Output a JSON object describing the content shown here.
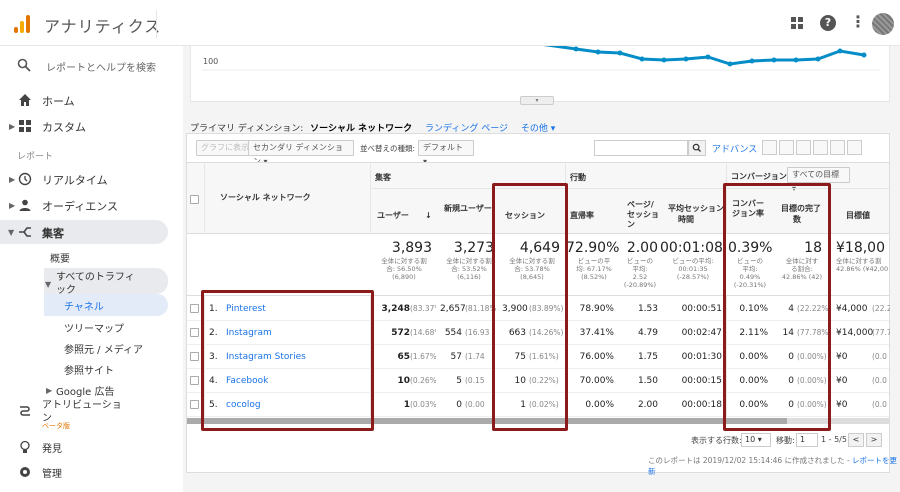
{
  "header": {
    "app_title": "アナリティクス"
  },
  "sidebar": {
    "search_placeholder": "レポートとヘルプを検索",
    "home": "ホーム",
    "custom": "カスタム",
    "section_report": "レポート",
    "realtime": "リアルタイム",
    "audience": "オーディエンス",
    "acquisition": "集客",
    "overview": "概要",
    "all_traffic_l1": "すべてのトラフィ",
    "all_traffic_l2": "ック",
    "channels": "チャネル",
    "treemap": "ツリーマップ",
    "source_medium": "参照元 / メディア",
    "referrals": "参照サイト",
    "google_ads": "Google 広告",
    "attribution_l1": "アトリビューショ",
    "attribution_l2": "ン",
    "beta": "ベータ版",
    "discover": "発見",
    "admin": "管理"
  },
  "chart": {
    "y_label": "100"
  },
  "dimension_bar": {
    "label": "プライマリ ディメンション:",
    "selected": "ソーシャル ネットワーク",
    "landing": "ランディング ページ",
    "other": "その他"
  },
  "toolbar": {
    "plot_rows": "グラフに表示",
    "secondary_dim": "セカンダリ ディメンション",
    "sort_type_label": "並べ替えの種類:",
    "sort_default": "デフォルト",
    "advanced": "アドバンス"
  },
  "table": {
    "dim_header": "ソーシャル ネットワーク",
    "group_acq": "集客",
    "group_behavior": "行動",
    "group_conv": "コンバージョン",
    "goal_select": "すべての目標",
    "cols": {
      "users": "ユーザー",
      "new_users": "新規ユーザー",
      "sessions": "セッション",
      "bounce": "直帰率",
      "pages_l1": "ページ/",
      "pages_l2": "セッショ",
      "pages_l3": "ン",
      "avg_dur_l1": "平均セッション",
      "avg_dur_l2": "時間",
      "conv_l1": "コンバー",
      "conv_l2": "ジョン率",
      "goal_comp_l1": "目標の完了",
      "goal_comp_l2": "数",
      "goal_value": "目標値"
    },
    "totals": {
      "users": "3,893",
      "users_sub1": "全体に対する割",
      "users_sub2": "合: 56.50%",
      "users_sub3": "(6,890)",
      "new_users": "3,273",
      "new_users_sub1": "全体に対する割",
      "new_users_sub2": "合: 53.52%",
      "new_users_sub3": "(6,116)",
      "sessions": "4,649",
      "sessions_sub1": "全体に対する割",
      "sessions_sub2": "合: 53.78%",
      "sessions_sub3": "(8,645)",
      "bounce": "72.90%",
      "bounce_sub1": "ビューの平",
      "bounce_sub2": "均: 67.17%",
      "bounce_sub3": "(8.52%)",
      "pages": "2.00",
      "pages_sub1": "ビューの",
      "pages_sub2": "平均:",
      "pages_sub3": "2.52",
      "pages_sub4": "(-20.89%)",
      "duration": "00:01:08",
      "duration_sub1": "ビューの平均:",
      "duration_sub2": "00:01:35",
      "duration_sub3": "(-28.57%)",
      "conv": "0.39%",
      "conv_sub1": "ビューの",
      "conv_sub2": "平均:",
      "conv_sub3": "0.49%",
      "conv_sub4": "(-20.31%)",
      "goals": "18",
      "goals_sub1": "全体に対す",
      "goals_sub2": "る割合:",
      "goals_sub3": "42.86% (42)",
      "value": "¥18,00",
      "value_sub1": "全体に対する割",
      "value_sub2": "42.86% (¥42,00"
    },
    "rows": [
      {
        "idx": "1.",
        "name": "Pinterest",
        "users": "3,248",
        "users_pct": "(83.37%)",
        "new": "2,657",
        "new_pct": "(81.18%",
        "sessions": "3,900",
        "sessions_pct": "(83.89%)",
        "bounce": "78.90%",
        "pages": "1.53",
        "duration": "00:00:51",
        "conv": "0.10%",
        "goals": "4",
        "goals_pct": "(22.22%)",
        "value": "¥4,000",
        "value_pct": "(22.2"
      },
      {
        "idx": "2.",
        "name": "Instagram",
        "users": "572",
        "users_pct": "(14.68%)",
        "new": "554",
        "new_pct": "(16.93",
        "sessions": "663",
        "sessions_pct": "(14.26%)",
        "bounce": "37.41%",
        "pages": "4.79",
        "duration": "00:02:47",
        "conv": "2.11%",
        "goals": "14",
        "goals_pct": "(77.78%)",
        "value": "¥14,000",
        "value_pct": "(77.7"
      },
      {
        "idx": "3.",
        "name": "Instagram Stories",
        "users": "65",
        "users_pct": "(1.67%)",
        "new": "57",
        "new_pct": "(1.74",
        "sessions": "75",
        "sessions_pct": "(1.61%)",
        "bounce": "76.00%",
        "pages": "1.75",
        "duration": "00:01:30",
        "conv": "0.00%",
        "goals": "0",
        "goals_pct": "(0.00%)",
        "value": "¥0",
        "value_pct": "(0.0"
      },
      {
        "idx": "4.",
        "name": "Facebook",
        "users": "10",
        "users_pct": "(0.26%)",
        "new": "5",
        "new_pct": "(0.15",
        "sessions": "10",
        "sessions_pct": "(0.22%)",
        "bounce": "70.00%",
        "pages": "1.50",
        "duration": "00:00:15",
        "conv": "0.00%",
        "goals": "0",
        "goals_pct": "(0.00%)",
        "value": "¥0",
        "value_pct": "(0.0"
      },
      {
        "idx": "5.",
        "name": "cocolog",
        "users": "1",
        "users_pct": "(0.03%)",
        "new": "0",
        "new_pct": "(0.00",
        "sessions": "1",
        "sessions_pct": "(0.02%)",
        "bounce": "0.00%",
        "pages": "2.00",
        "duration": "00:00:18",
        "conv": "0.00%",
        "goals": "0",
        "goals_pct": "(0.00%)",
        "value": "¥0",
        "value_pct": "(0.0"
      }
    ]
  },
  "pager": {
    "rows_label": "表示する行数:",
    "rows_value": "10",
    "goto_label": "移動:",
    "goto_value": "1",
    "range": "1 - 5/5"
  },
  "footer": {
    "created_text": "このレポートは 2019/12/02 15:14:46 に作成されました -",
    "refresh_link": "レポートを更新"
  }
}
